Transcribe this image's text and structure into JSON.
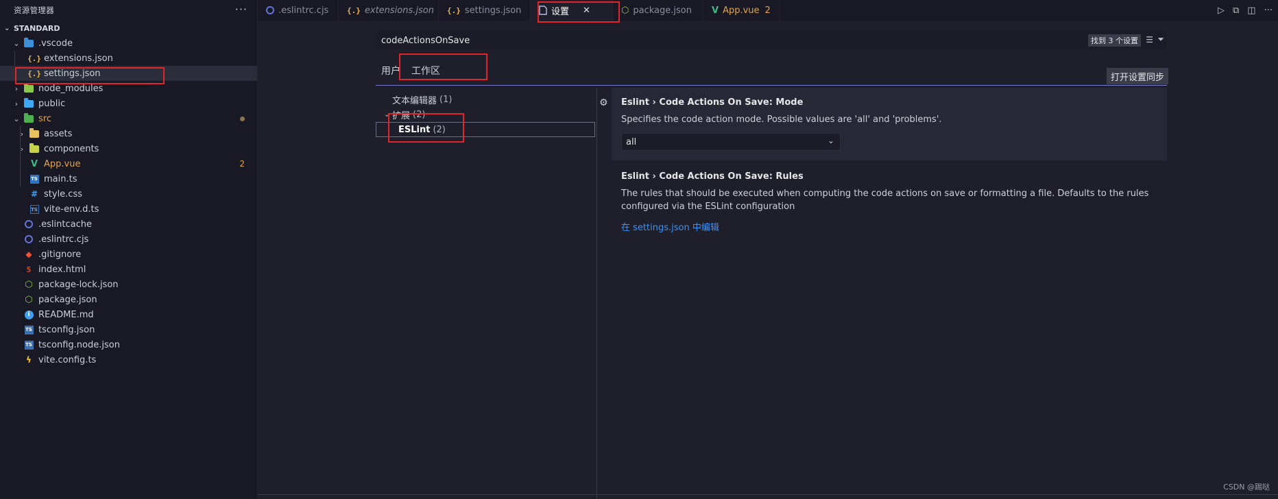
{
  "explorer": {
    "title": "资源管理器",
    "more": "···",
    "root": "STANDARD",
    "items": [
      {
        "label": ".vscode",
        "icon": "folder-vscode-icon"
      },
      {
        "label": "extensions.json",
        "icon": "json-icon"
      },
      {
        "label": "settings.json",
        "icon": "json-icon"
      },
      {
        "label": "node_modules",
        "icon": "folder-node-icon"
      },
      {
        "label": "public",
        "icon": "folder-public-icon"
      },
      {
        "label": "src",
        "icon": "folder-src-icon"
      },
      {
        "label": "assets",
        "icon": "folder-icon"
      },
      {
        "label": "components",
        "icon": "folder-icon"
      },
      {
        "label": "App.vue",
        "icon": "vue-icon",
        "badge": "2"
      },
      {
        "label": "main.ts",
        "icon": "typescript-icon"
      },
      {
        "label": "style.css",
        "icon": "css-icon"
      },
      {
        "label": "vite-env.d.ts",
        "icon": "typescript-def-icon"
      },
      {
        "label": ".eslintcache",
        "icon": "eslint-icon"
      },
      {
        "label": ".eslintrc.cjs",
        "icon": "eslint-icon"
      },
      {
        "label": ".gitignore",
        "icon": "git-icon"
      },
      {
        "label": "index.html",
        "icon": "html-icon"
      },
      {
        "label": "package-lock.json",
        "icon": "node-icon"
      },
      {
        "label": "package.json",
        "icon": "node-icon"
      },
      {
        "label": "README.md",
        "icon": "info-icon"
      },
      {
        "label": "tsconfig.json",
        "icon": "tsconfig-icon"
      },
      {
        "label": "tsconfig.node.json",
        "icon": "tsconfig-icon"
      },
      {
        "label": "vite.config.ts",
        "icon": "vite-icon"
      }
    ]
  },
  "tabs": [
    {
      "label": ".eslintrc.cjs",
      "icon": "eslint-icon"
    },
    {
      "label": "extensions.json",
      "icon": "json-icon"
    },
    {
      "label": "settings.json",
      "icon": "json-icon"
    },
    {
      "label": "设置",
      "icon": "file-icon",
      "close": "✕"
    },
    {
      "label": "package.json",
      "icon": "node-icon"
    },
    {
      "label": "App.vue",
      "icon": "vue-icon",
      "badge": "2"
    }
  ],
  "settings_editor": {
    "search_value": "codeActionsOnSave",
    "result_count": "找到 3 个设置",
    "scope_user": "用户",
    "scope_workspace": "工作区",
    "sync_button": "打开设置同步",
    "toc": [
      {
        "label": "文本编辑器",
        "count": "(1)"
      },
      {
        "label": "扩展",
        "count": "(2)"
      },
      {
        "label": "ESLint",
        "count": "(2)"
      }
    ],
    "settings": [
      {
        "category": "Eslint › ",
        "title": "Code Actions On Save: Mode",
        "description": "Specifies the code action mode. Possible values are 'all' and 'problems'.",
        "value": "all"
      },
      {
        "category": "Eslint › ",
        "title": "Code Actions On Save: Rules",
        "description": "The rules that should be executed when computing the code actions on save or formatting a file. Defaults to the rules configured via the ESLint configuration",
        "link": "在 settings.json 中编辑"
      }
    ]
  },
  "watermark": "CSDN @踢哒",
  "colors": {
    "accent": "#3794ff",
    "highlight": "#e0262b",
    "badge": "#e2a54b"
  }
}
